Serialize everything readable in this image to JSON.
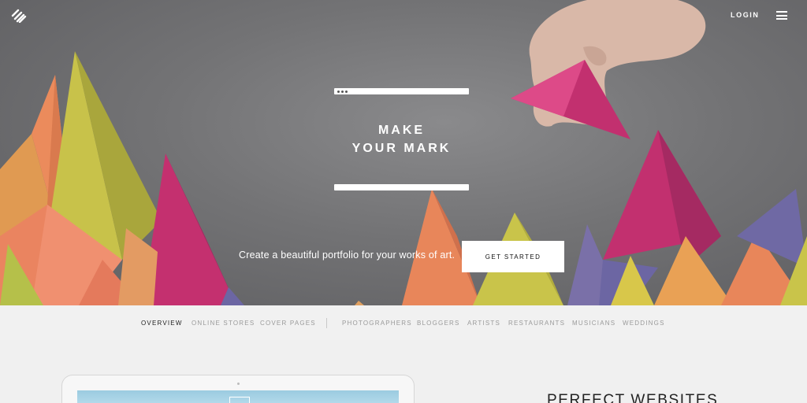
{
  "header": {
    "logo_icon": "squarespace-logo-icon",
    "login_label": "LOGIN",
    "menu_icon": "hamburger-menu-icon"
  },
  "hero": {
    "headline_line1": "MAKE",
    "headline_line2": "YOUR MARK",
    "tagline": "Create a beautiful portfolio for your works of art.",
    "cta_label": "GET STARTED",
    "colors": {
      "background": "#6e6e70",
      "pink": "#c2306f",
      "orange": "#e8865a",
      "yellow": "#c9c44a",
      "purple": "#6c66a3"
    }
  },
  "subnav": {
    "items": [
      {
        "label": "OVERVIEW",
        "active": true
      },
      {
        "label": "ONLINE STORES",
        "active": false
      },
      {
        "label": "COVER PAGES",
        "active": false
      },
      {
        "label": "PHOTOGRAPHERS",
        "active": false
      },
      {
        "label": "BLOGGERS",
        "active": false
      },
      {
        "label": "ARTISTS",
        "active": false
      },
      {
        "label": "RESTAURANTS",
        "active": false
      },
      {
        "label": "MUSICIANS",
        "active": false
      },
      {
        "label": "WEDDINGS",
        "active": false
      }
    ]
  },
  "section": {
    "heading": "PERFECT WEBSITES"
  }
}
